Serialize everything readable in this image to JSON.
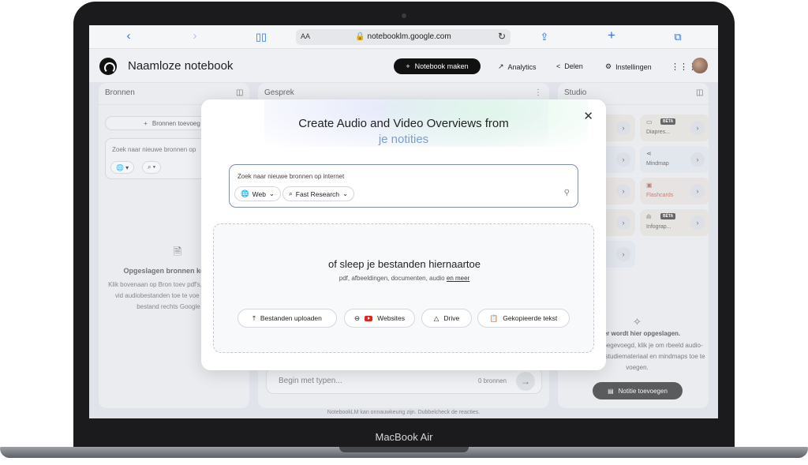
{
  "device": {
    "label": "MacBook Air"
  },
  "browser": {
    "aa": "AA",
    "url": "notebooklm.google.com",
    "icons": [
      "back-icon",
      "forward-icon",
      "bookmarks-icon",
      "reload-icon",
      "share-icon",
      "new-tab-icon",
      "tabs-icon"
    ]
  },
  "header": {
    "title": "Naamloze notebook",
    "make_button": "Notebook maken",
    "analytics": "Analytics",
    "share": "Delen",
    "settings": "Instellingen"
  },
  "sources": {
    "title": "Bronnen",
    "add_button": "Bronnen toevoeg",
    "search_placeholder": "Zoek naar nieuwe bronnen op",
    "empty_title": "Opgeslagen bronnen kom staan",
    "empty_text": "Klik bovenaan op Bron toev pdf's, websites, tekst, vid audiobestanden toe te voe importeer een bestand rechts Google Drive."
  },
  "chat": {
    "title": "Gesprek",
    "input_placeholder": "Begin met typen...",
    "source_count": "0 bronnen"
  },
  "studio": {
    "title": "Studio",
    "cards": [
      {
        "label": "Diapres...",
        "badge": "BÈTA",
        "color": "#e7e3dc"
      },
      {
        "label": "Mindmap",
        "badge": "",
        "color": "#e2e6ee"
      },
      {
        "label": "Flashcards",
        "badge": "",
        "color": "#ece2df"
      },
      {
        "label": "Infograp...",
        "badge": "BÈTA",
        "color": "#e7e3dc"
      }
    ],
    "note_title": "tvoer wordt hier opgeslagen.",
    "note_text": "nnen hebt toegevoegd, klik je om rbeeld audio-overzichten, studiemateriaal en mindmaps toe te voegen.",
    "add_note_button": "Notitie toevoegen"
  },
  "footer": "NotebookLM kan onnauwkeurig zijn. Dubbelcheck de reacties.",
  "modal": {
    "title": "Create Audio and Video Overviews from",
    "subtitle": "je notities",
    "search_placeholder": "Zoek naar nieuwe bronnen op internet",
    "web_chip": "Web",
    "research_chip": "Fast Research",
    "drop_title": "of sleep je bestanden hiernaartoe",
    "drop_sub": "pdf, afbeeldingen, documenten, audio",
    "drop_link": "en meer",
    "buttons": {
      "upload": "Bestanden uploaden",
      "websites": "Websites",
      "drive": "Drive",
      "pasted": "Gekopieerde tekst"
    }
  }
}
